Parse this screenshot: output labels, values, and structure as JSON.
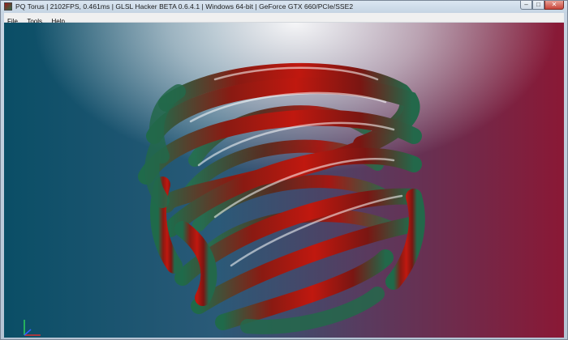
{
  "window": {
    "title": "PQ Torus | 2102FPS, 0.461ms | GLSL Hacker BETA 0.6.4.1 | Windows 64-bit | GeForce GTX 660/PCIe/SSE2",
    "controls": {
      "minimize": "–",
      "maximize": "□",
      "close": "✕"
    }
  },
  "menu": {
    "items": [
      {
        "label": "File"
      },
      {
        "label": "Tools"
      },
      {
        "label": "Help"
      }
    ]
  },
  "icons": {
    "app": "app-icon",
    "minimize": "minimize-icon",
    "maximize": "maximize-icon",
    "close": "close-icon",
    "axes": "xyz-axes-icon"
  },
  "colors": {
    "torus_red": "#b3140f",
    "torus_green": "#23684a",
    "background_left": "#0a4e66",
    "background_right": "#8a1835"
  }
}
